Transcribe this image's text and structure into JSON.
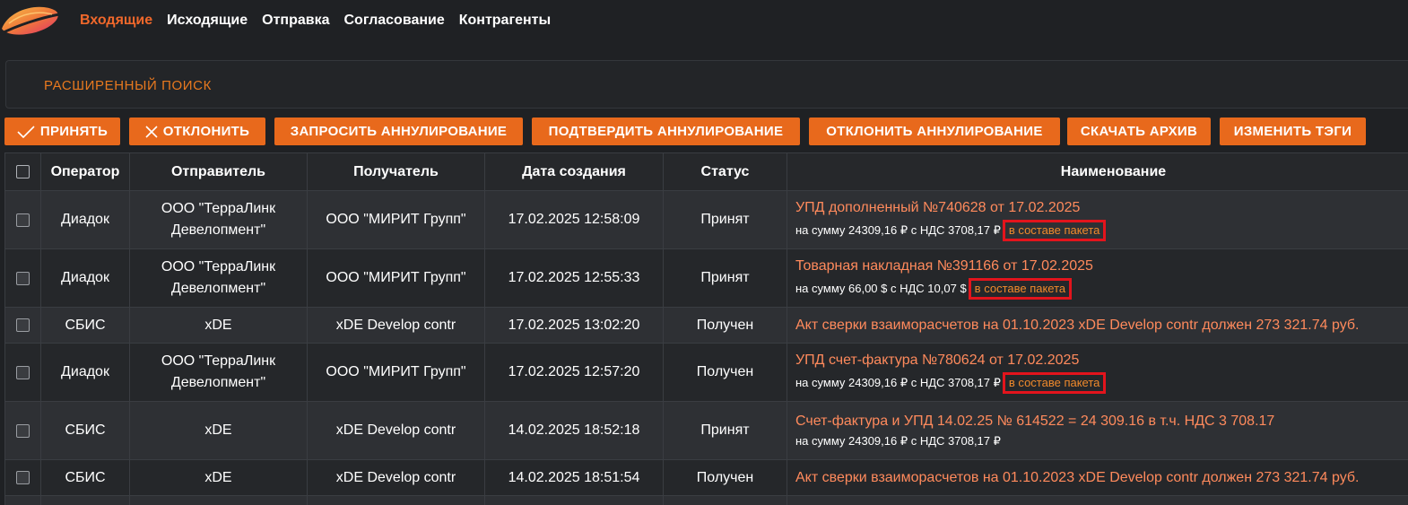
{
  "nav": {
    "items": [
      "Входящие",
      "Исходящие",
      "Отправка",
      "Согласование",
      "Контрагенты"
    ],
    "active": "Входящие",
    "accent_color": "#f0682b"
  },
  "search": {
    "label": "РАСШИРЕННЫЙ ПОИСК"
  },
  "toolbar": {
    "accept": "ПРИНЯТЬ",
    "reject": "ОТКЛОНИТЬ",
    "request_cancel": "ЗАПРОСИТЬ АННУЛИРОВАНИЕ",
    "confirm_cancel": "ПОДТВЕРДИТЬ АННУЛИРОВАНИЕ",
    "reject_cancel": "ОТКЛОНИТЬ АННУЛИРОВАНИЕ",
    "download_archive": "СКАЧАТЬ АРХИВ",
    "change_tags": "ИЗМЕНИТЬ ТЭГИ",
    "button_color": "#e8691c"
  },
  "table": {
    "headers": {
      "operator": "Оператор",
      "sender": "Отправитель",
      "recipient": "Получатель",
      "created": "Дата создания",
      "status": "Статус",
      "name": "Наименование"
    },
    "rows": [
      {
        "operator": "Диадок",
        "sender": [
          "ООО \"ТерраЛинк",
          "Девелопмент\""
        ],
        "recipient": "ООО \"МИРИТ Групп\"",
        "created": "17.02.2025 12:58:09",
        "status": "Принят",
        "title": "УПД дополненный №740628 от 17.02.2025",
        "amount": "на сумму 24309,16 ₽ с НДС 3708,17 ₽",
        "package": "в составе пакета"
      },
      {
        "operator": "Диадок",
        "sender": [
          "ООО \"ТерраЛинк",
          "Девелопмент\""
        ],
        "recipient": "ООО \"МИРИТ Групп\"",
        "created": "17.02.2025 12:55:33",
        "status": "Принят",
        "title": "Товарная накладная №391166 от 17.02.2025",
        "amount": "на сумму 66,00 $ с НДС 10,07 $",
        "package": "в составе пакета"
      },
      {
        "operator": "СБИС",
        "sender": [
          "xDE"
        ],
        "recipient": "xDE Develop contr",
        "created": "17.02.2025 13:02:20",
        "status": "Получен",
        "title": "Акт сверки взаиморасчетов на 01.10.2023 xDE Develop contr должен 273 321.74 руб.",
        "amount": "",
        "package": ""
      },
      {
        "operator": "Диадок",
        "sender": [
          "ООО \"ТерраЛинк",
          "Девелопмент\""
        ],
        "recipient": "ООО \"МИРИТ Групп\"",
        "created": "17.02.2025 12:57:20",
        "status": "Получен",
        "title": "УПД счет-фактура №780624 от 17.02.2025",
        "amount": "на сумму 24309,16 ₽ с НДС 3708,17 ₽",
        "package": "в составе пакета"
      },
      {
        "operator": "СБИС",
        "sender": [
          "xDE"
        ],
        "recipient": "xDE Develop contr",
        "created": "14.02.2025 18:52:18",
        "status": "Принят",
        "title": "Счет-фактура и УПД 14.02.25 № 614522 = 24 309.16 в т.ч. НДС 3 708.17",
        "amount": "на сумму 24309,16 ₽ с НДС 3708,17 ₽",
        "package": ""
      },
      {
        "operator": "СБИС",
        "sender": [
          "xDE"
        ],
        "recipient": "xDE Develop contr",
        "created": "14.02.2025 18:51:54",
        "status": "Получен",
        "title": "Акт сверки взаиморасчетов на 01.10.2023 xDE Develop contr должен 273 321.74 руб.",
        "amount": "",
        "package": ""
      }
    ]
  }
}
